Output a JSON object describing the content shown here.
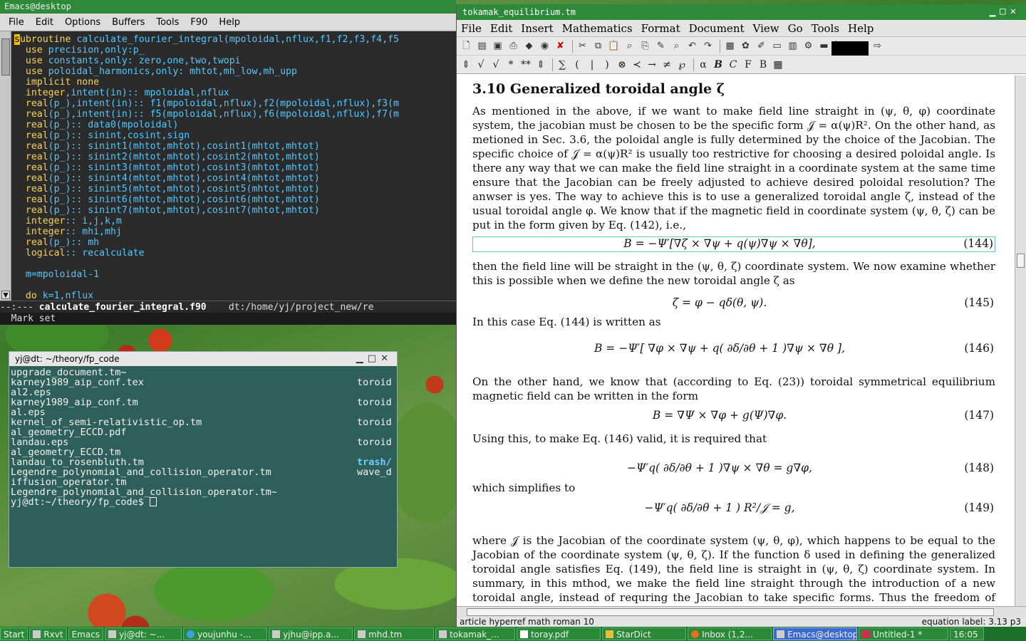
{
  "emacs": {
    "title": "Emacs@desktop",
    "menu": [
      "File",
      "Edit",
      "Options",
      "Buffers",
      "Tools",
      "F90",
      "Help"
    ],
    "code_lines": [
      {
        "pre": "",
        "kw": "subroutine",
        "post": " calculate_fourier_integral(mpoloidal,nflux,f1,f2,f3,f4,f5"
      },
      {
        "pre": "  ",
        "kw": "use",
        "post": " precision,only:p_"
      },
      {
        "pre": "  ",
        "kw": "use",
        "post": " constants,only: zero,one,two,twopi"
      },
      {
        "pre": "  ",
        "kw": "use",
        "post": " poloidal_harmonics,only: mhtot,mh_low,mh_upp"
      },
      {
        "pre": "  ",
        "kw": "implicit none",
        "post": ""
      },
      {
        "pre": "  ",
        "kw": "integer",
        "post": ",intent(in):: mpoloidal,nflux"
      },
      {
        "pre": "  ",
        "kw": "real",
        "post": "(p_),intent(in):: f1(mpoloidal,nflux),f2(mpoloidal,nflux),f3(m"
      },
      {
        "pre": "  ",
        "kw": "real",
        "post": "(p_),intent(in):: f5(mpoloidal,nflux),f6(mpoloidal,nflux),f7(m"
      },
      {
        "pre": "  ",
        "kw": "real",
        "post": "(p_):: data0(mpoloidal)"
      },
      {
        "pre": "  ",
        "kw": "real",
        "post": "(p_):: sinint,cosint,sign"
      },
      {
        "pre": "  ",
        "kw": "real",
        "post": "(p_):: sinint1(mhtot,mhtot),cosint1(mhtot,mhtot)"
      },
      {
        "pre": "  ",
        "kw": "real",
        "post": "(p_):: sinint2(mhtot,mhtot),cosint2(mhtot,mhtot)"
      },
      {
        "pre": "  ",
        "kw": "real",
        "post": "(p_):: sinint3(mhtot,mhtot),cosint3(mhtot,mhtot)"
      },
      {
        "pre": "  ",
        "kw": "real",
        "post": "(p_):: sinint4(mhtot,mhtot),cosint4(mhtot,mhtot)"
      },
      {
        "pre": "  ",
        "kw": "real",
        "post": "(p_):: sinint5(mhtot,mhtot),cosint5(mhtot,mhtot)"
      },
      {
        "pre": "  ",
        "kw": "real",
        "post": "(p_):: sinint6(mhtot,mhtot),cosint6(mhtot,mhtot)"
      },
      {
        "pre": "  ",
        "kw": "real",
        "post": "(p_):: sinint7(mhtot,mhtot),cosint7(mhtot,mhtot)"
      },
      {
        "pre": "  ",
        "kw": "integer",
        "post": ":: i,j,k,m"
      },
      {
        "pre": "  ",
        "kw": "integer",
        "post": ":: mhi,mhj"
      },
      {
        "pre": "  ",
        "kw": "real",
        "post": "(p_):: mh"
      },
      {
        "pre": "  ",
        "kw": "logical",
        "post": ":: recalculate"
      },
      {
        "pre": "",
        "kw": "",
        "post": ""
      },
      {
        "pre": "  ",
        "kw": "",
        "post": "m=mpoloidal-1"
      },
      {
        "pre": "",
        "kw": "",
        "post": ""
      },
      {
        "pre": "  ",
        "kw": "do",
        "post": " k=1,nflux"
      }
    ],
    "modeline_prefix": "--:--- ",
    "modeline_file": "calculate_fourier_integral.f90",
    "modeline_path": "    dt:/home/yj/project_new/re",
    "echo": "  Mark set"
  },
  "terminal": {
    "title": "yj@dt: ~/theory/fp_code",
    "rows": [
      {
        "l": "upgrade_document.tm~",
        "r": ""
      },
      {
        "l": "karney1989_aip_conf.tex",
        "r": "toroid"
      },
      {
        "l": "al2.eps",
        "r": ""
      },
      {
        "l": "karney1989_aip_conf.tm",
        "r": "toroid"
      },
      {
        "l": "al.eps",
        "r": ""
      },
      {
        "l": "kernel_of_semi-relativistic_op.tm",
        "r": "toroid"
      },
      {
        "l": "al_geometry_ECCD.pdf",
        "r": ""
      },
      {
        "l": "landau.eps",
        "r": "toroid"
      },
      {
        "l": "al_geometry_ECCD.tm",
        "r": ""
      },
      {
        "l": "landau_to_rosenbluth.tm",
        "r": "trash/"
      },
      {
        "l": "Legendre_polynomial_and_collision_operator.tm",
        "r": "wave_d"
      },
      {
        "l": "iffusion_operator.tm",
        "r": ""
      },
      {
        "l": "Legendre_polynomial_and_collision_operator.tm~",
        "r": ""
      },
      {
        "l": "yj@dt:~/theory/fp_code$ ",
        "r": ""
      }
    ]
  },
  "texmacs": {
    "title": "tokamak_equilibrium.tm",
    "menu": [
      "File",
      "Edit",
      "Insert",
      "Mathematics",
      "Format",
      "Document",
      "View",
      "Go",
      "Tools",
      "Help"
    ],
    "toolbar_math": [
      "⇕",
      "√",
      "√",
      "*",
      "**",
      "⇕",
      "∑",
      "(",
      "|",
      ")",
      "⊗",
      "≺",
      "→",
      "≠",
      "℘",
      "α",
      "B",
      "C",
      "F",
      "B",
      "▦"
    ],
    "section": "3.10  Generalized toroidal angle ζ",
    "p1": "As mentioned in the above, if we want to make field line straight in (ψ, θ, φ) coordinate system, the jacobian must be chosen to be the specific form 𝒥 = α(ψ)R². On the other hand, as metioned in Sec. 3.6, the poloidal angle is fully determined by the choice of the Jacobian. The specific choice of 𝒥 = α(ψ)R² is usually too restrictive for choosing a desired poloidal angle. Is there any way that we can make the field line straight in a coordinate system at the same time ensure that the Jacobian can be freely adjusted to achieve desired poloidal resolution? The anwser is yes. The way to achieve this is to use a generalized toroidal angle ζ, instead of the usual toroidal angle φ. We know that if the magnetic field in coordinate system (ψ, θ, ζ) can be put in the form given by Eq. (142), i.e.,",
    "eq144": "B = −Ψ′[∇ζ × ∇ψ + q(ψ)∇ψ × ∇θ],",
    "eq144_num": "(144)",
    "p2": "then the field line will be straight in the (ψ, θ, ζ) coordinate system. We now examine whether this is possible when we define the new toroidal angle ζ as",
    "eq145": "ζ = φ − qδ(θ, ψ).",
    "eq145_num": "(145)",
    "p3": "In this case Eq. (144) is written as",
    "eq146": "B = −Ψ′[ ∇φ × ∇ψ + q( ∂δ/∂θ + 1 )∇ψ × ∇θ ],",
    "eq146_num": "(146)",
    "p4": "On the other hand, we know that (according to Eq. (23)) toroidal symmetrical equilibrium magnetic field can be written in the form",
    "eq147": "B = ∇Ψ × ∇φ + g(Ψ)∇φ.",
    "eq147_num": "(147)",
    "p5": "Using this, to make Eq. (146) valid, it is required that",
    "eq148": "−Ψ′q( ∂δ/∂θ + 1 )∇ψ × ∇θ = g∇φ,",
    "eq148_num": "(148)",
    "p6": "which simplifies to",
    "eq149": "−Ψ′q( ∂δ/∂θ + 1 ) R²/𝒥 = g,",
    "eq149_num": "(149)",
    "p7": "where 𝒥 is the Jacobian of the coordinate system (ψ, θ, φ), which happens to be equal to the Jacobian of the coordinate system (ψ, θ, ζ). If the function δ used in defining the generalized toroidal angle satisfies Eq. (149), the field line is straight in (ψ, θ, ζ) coordinate system. In summary, in this mthod, we make the field line straight through the introduction of a new toroidal angle, instead of requring the Jacobian to take specific forms. Thus the freedom of choosing the form of the Jacobian",
    "status_left": "article hyperref math roman 10",
    "status_right": "equation label: 3.13 p3"
  },
  "taskbar": {
    "items": [
      "Start",
      "Rxvt",
      "Emacs",
      "yj@dt: ~...",
      "youjunhu -...",
      "yjhu@ipp.a...",
      "mhd.tm",
      "tokamak_...",
      "toray.pdf",
      "StarDict",
      "Inbox (1,2...",
      "Emacs@desktop",
      "Untitled-1 *",
      "16:05"
    ]
  },
  "colors": {
    "emacs_title": "#2e8a3a",
    "keyword": "#ffd24a",
    "type": "#53c8ff",
    "terminal_bg": "#2f5f5a",
    "taskbar": "#1e6e2c"
  }
}
